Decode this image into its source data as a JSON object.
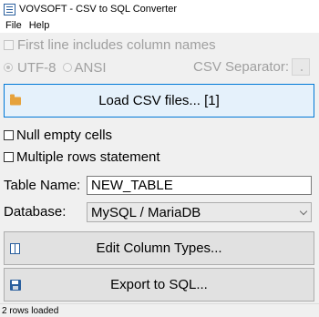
{
  "window": {
    "title": "VOVSOFT - CSV to SQL Converter"
  },
  "menu": {
    "file": "File",
    "help": "Help"
  },
  "options": {
    "first_line_header": "First line includes column names",
    "encoding_utf8": "UTF-8",
    "encoding_ansi": "ANSI",
    "csv_separator_label": "CSV Separator:",
    "csv_separator_value": ","
  },
  "buttons": {
    "load_csv": "Load CSV files... [1]",
    "edit_column_types": "Edit Column Types...",
    "export_sql": "Export to SQL..."
  },
  "checks": {
    "null_empty_cells": "Null empty cells",
    "multiple_rows_statement": "Multiple rows statement"
  },
  "fields": {
    "table_name_label": "Table Name:",
    "table_name_value": "NEW_TABLE",
    "database_label": "Database:",
    "database_value": "MySQL / MariaDB"
  },
  "status": {
    "text": "2 rows loaded"
  }
}
